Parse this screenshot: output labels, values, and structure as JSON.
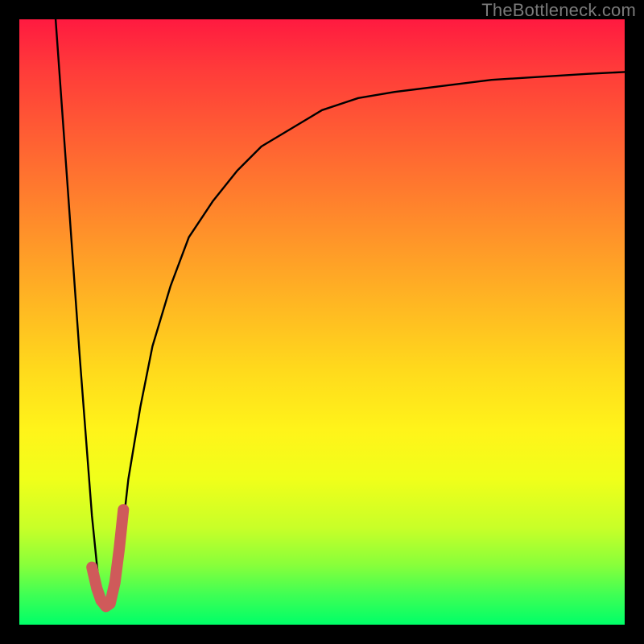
{
  "watermark": "TheBottleneck.com",
  "colors": {
    "frame": "#000000",
    "curve": "#000000",
    "highlight": "#cf5a5a",
    "gradient_stops": [
      "#ff1a40",
      "#ff3a3a",
      "#ff5a34",
      "#ff7a2e",
      "#ff9a28",
      "#ffba22",
      "#ffda1c",
      "#fff41a",
      "#f0ff1a",
      "#c8ff28",
      "#8aff3a",
      "#40ff54",
      "#00ff68"
    ]
  },
  "chart_data": {
    "type": "line",
    "title": "",
    "xlabel": "",
    "ylabel": "",
    "xlim": [
      0,
      100
    ],
    "ylim": [
      0,
      100
    ],
    "grid": false,
    "legend": false,
    "note": "x/y are percent of plot area (0,0 = top-left). Values estimated from pixels.",
    "series": [
      {
        "name": "bottleneck-curve",
        "color": "#000000",
        "x": [
          6,
          8,
          10,
          12,
          13,
          14,
          15,
          16,
          17,
          18,
          20,
          22,
          25,
          28,
          32,
          36,
          40,
          45,
          50,
          56,
          62,
          70,
          78,
          86,
          94,
          100
        ],
        "y": [
          0,
          28,
          56,
          82,
          92,
          96,
          97,
          93,
          85,
          76,
          64,
          54,
          44,
          36,
          30,
          25,
          21,
          18,
          15,
          13,
          12,
          11,
          10,
          9.5,
          9,
          8.7
        ]
      }
    ],
    "highlight_segment": {
      "name": "trough-marker",
      "color": "#cf5a5a",
      "stroke_width_px": 14,
      "x": [
        12.0,
        12.8,
        13.5,
        14.3,
        15.0,
        15.8,
        16.5,
        17.2
      ],
      "y": [
        90.5,
        94.0,
        96.0,
        97.0,
        96.5,
        93.0,
        87.5,
        81.0
      ]
    }
  }
}
